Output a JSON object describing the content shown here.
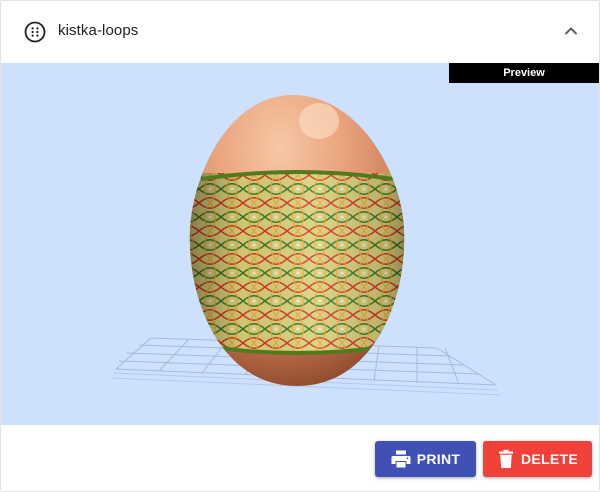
{
  "header": {
    "title": "kistka-loops",
    "menu_icon": "dots-circle-icon",
    "collapse_icon": "chevron-up-icon"
  },
  "viewer": {
    "badge": "Preview",
    "background": "#cde0fe"
  },
  "actions": {
    "print_label": "PRINT",
    "print_icon": "printer-icon",
    "print_color": "#3f51b5",
    "delete_label": "DELETE",
    "delete_icon": "trash-icon",
    "delete_color": "#f2413b"
  }
}
